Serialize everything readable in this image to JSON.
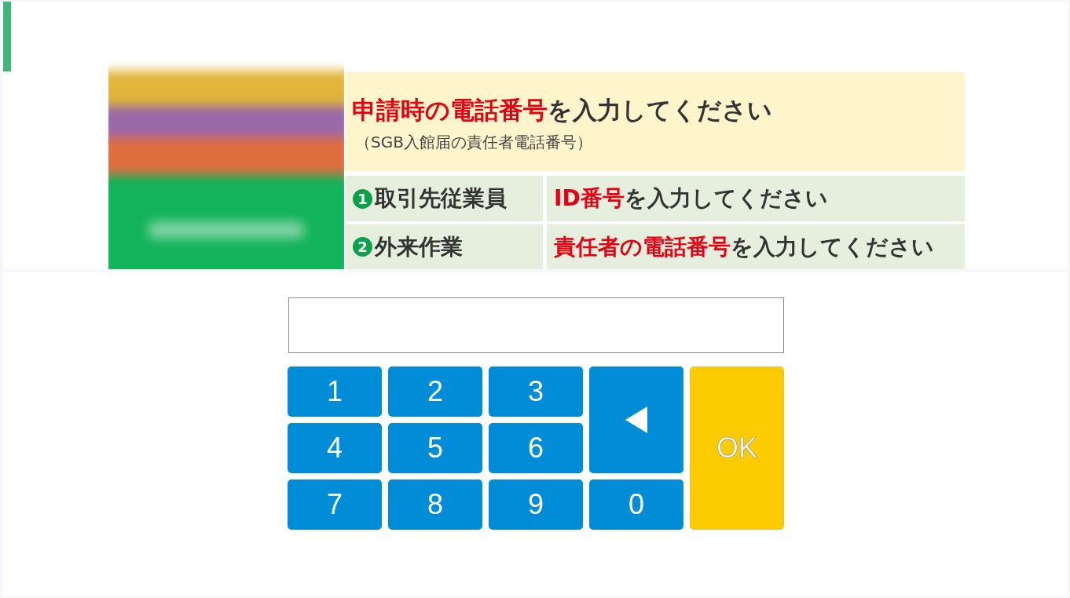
{
  "heading": {
    "highlight": "申請時の電話番号",
    "rest": "を入力してください",
    "note": "（SGB入館届の責任者電話番号）"
  },
  "options": [
    {
      "number": "1",
      "label": "取引先従業員",
      "instruction": {
        "highlight": "ID番号",
        "rest": "を入力してください"
      }
    },
    {
      "number": "2",
      "label": "外来作業",
      "instruction": {
        "highlight": "責任者の電話番号",
        "rest": "を入力してください"
      }
    }
  ],
  "keypad": [
    {
      "kind": "digit",
      "label": "1"
    },
    {
      "kind": "digit",
      "label": "2"
    },
    {
      "kind": "digit",
      "label": "3"
    },
    {
      "kind": "backspace"
    },
    {
      "kind": "digit",
      "label": "4"
    },
    {
      "kind": "digit",
      "label": "5"
    },
    {
      "kind": "digit",
      "label": "6"
    },
    {
      "kind": "ok",
      "label": "OK"
    },
    {
      "kind": "digit",
      "label": "7"
    },
    {
      "kind": "digit",
      "label": "8"
    },
    {
      "kind": "digit",
      "label": "9"
    },
    {
      "kind": "digit",
      "label": "0"
    }
  ]
}
